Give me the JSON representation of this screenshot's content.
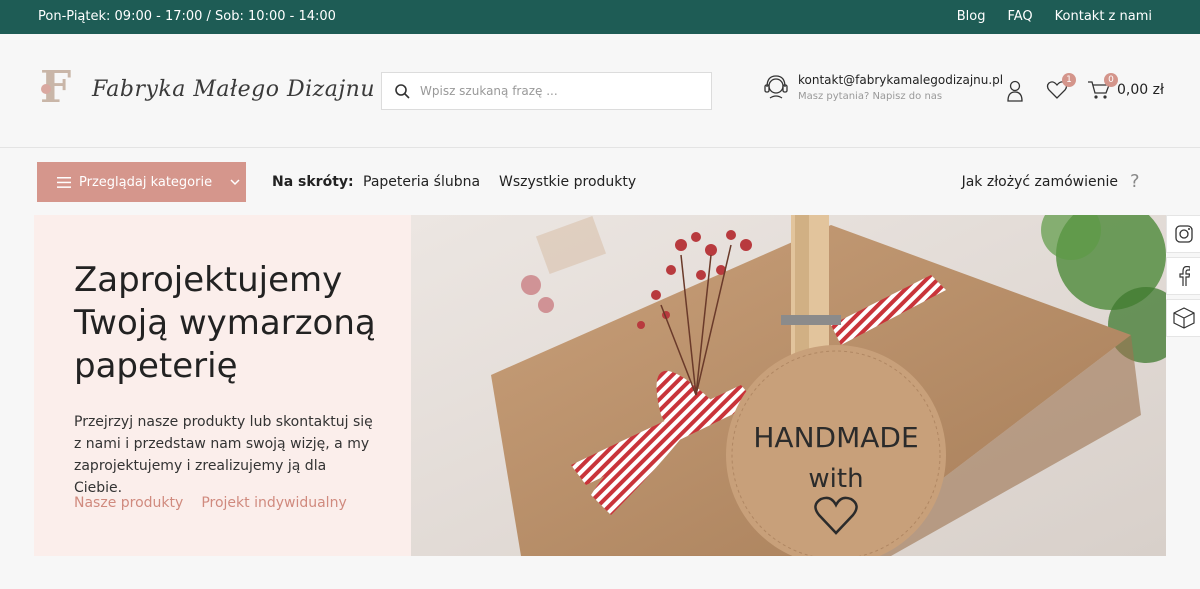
{
  "topbar": {
    "hours": "Pon-Piątek: 09:00 - 17:00 / Sob: 10:00 - 14:00",
    "links": [
      "Blog",
      "FAQ",
      "Kontakt z nami"
    ]
  },
  "header": {
    "logo_text": "Fabryka Małego Dizajnu",
    "search_placeholder": "Wpisz szukaną frazę ...",
    "contact_email": "kontakt@fabrykamalegodizajnu.pl",
    "contact_hint": "Masz pytania? Napisz do nas",
    "wishlist_count": "1",
    "cart_count": "0",
    "cart_total": "0,00 zł"
  },
  "nav": {
    "categories_label": "Przeglądaj kategorie",
    "shortcuts_label": "Na skróty:",
    "links": [
      "Papeteria ślubna",
      "Wszystkie produkty"
    ],
    "how_to_order": "Jak złożyć zamówienie"
  },
  "hero": {
    "title": "Zaprojektujemy Twoją wymarzoną papeterię",
    "description": "Przejrzyj nasze produkty lub skontaktuj się z nami i przedstaw nam swoją wizję, a my zaprojektujemy i zrealizujemy ją dla Ciebie.",
    "link_products": "Nasze produkty",
    "link_custom": "Projekt indywidualny",
    "tag_line1": "HANDMADE",
    "tag_line2": "with"
  },
  "colors": {
    "topbar": "#1e5c55",
    "accent": "#d5968c",
    "hero_bg": "#fbeeeb"
  },
  "icons": [
    "search-icon",
    "headset-icon",
    "user-icon",
    "heart-icon",
    "cart-icon",
    "menu-icon",
    "chevron-down-icon",
    "help-icon",
    "instagram-icon",
    "facebook-icon",
    "box-icon"
  ]
}
